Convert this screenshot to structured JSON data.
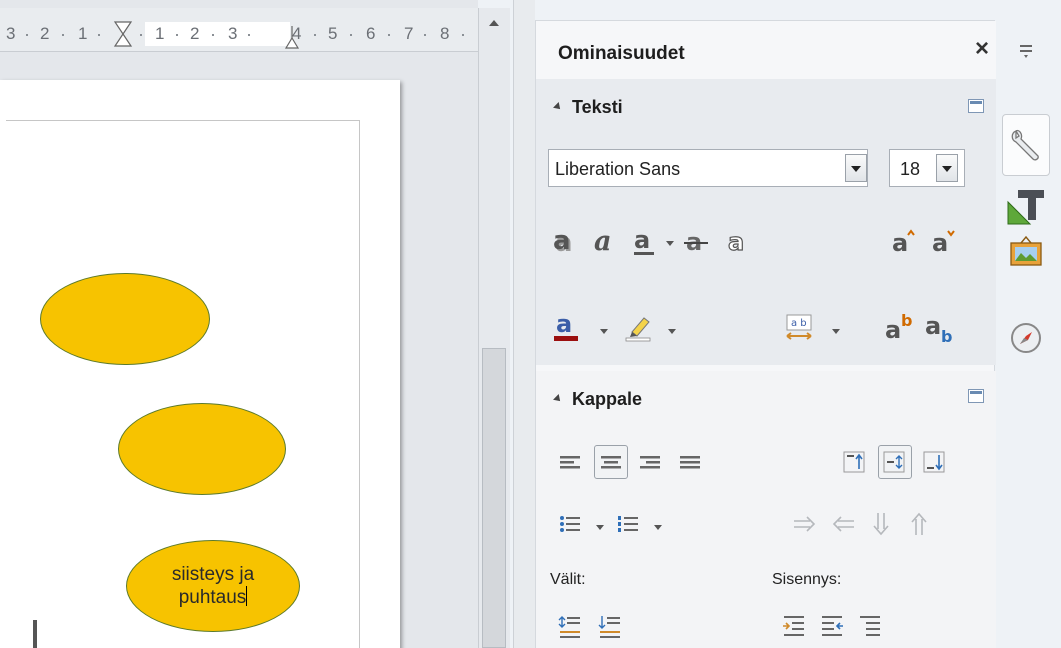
{
  "panel": {
    "title": "Ominaisuudet",
    "close_symbol": "×"
  },
  "text_section": {
    "title": "Teksti",
    "font_name": "Liberation Sans",
    "font_size": "18"
  },
  "paragraph_section": {
    "title": "Kappale",
    "spacing_label": "Välit:",
    "indent_label": "Sisennys:"
  },
  "ruler": {
    "numbers": [
      "3",
      "2",
      "1",
      "1",
      "2",
      "3",
      "4",
      "5",
      "6",
      "7",
      "8"
    ]
  },
  "document": {
    "shape_text": "siisteys ja\npuhtaus"
  },
  "icons": {
    "text_tools": [
      "shadow-icon",
      "italic-icon",
      "underline-icon",
      "strikethrough-icon",
      "outline-icon",
      "grow-font-icon",
      "shrink-font-icon"
    ],
    "color_tools": [
      "font-color-icon",
      "highlight-icon",
      "char-spacing-icon",
      "superscript-icon",
      "subscript-icon"
    ],
    "tabs": [
      "properties-wrench-icon",
      "styles-icon",
      "gallery-icon",
      "navigator-icon"
    ]
  },
  "colors": {
    "ellipse_fill": "#f7c300",
    "ellipse_border": "#5c7a2a",
    "font_color_bar": "#9b0f0f"
  }
}
